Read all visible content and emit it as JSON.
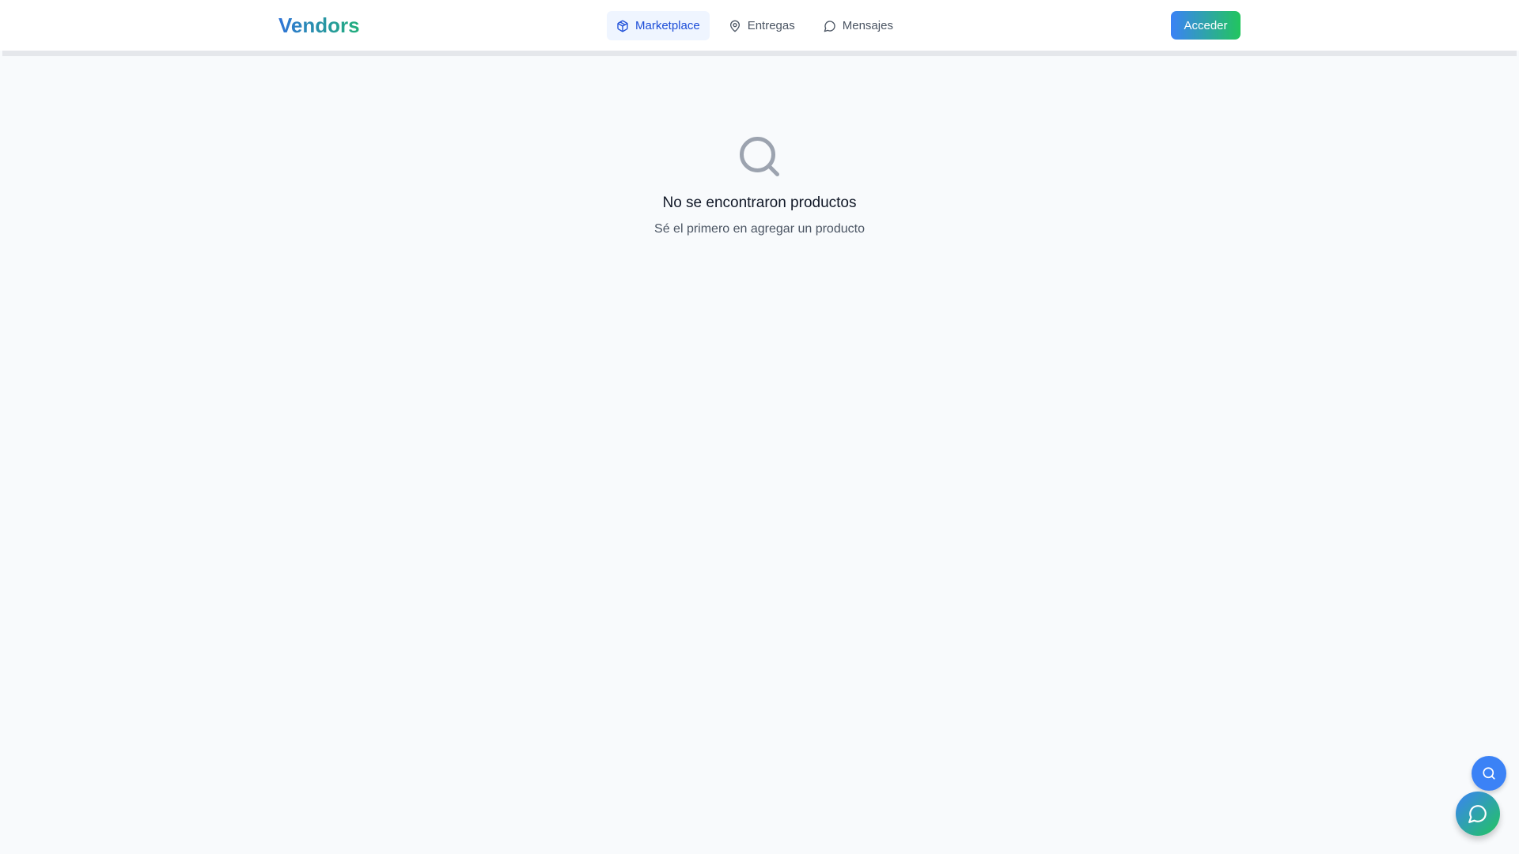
{
  "header": {
    "logo": "Vendors",
    "nav": [
      {
        "label": "Marketplace",
        "icon": "package-icon",
        "active": true
      },
      {
        "label": "Entregas",
        "icon": "map-pin-icon",
        "active": false
      },
      {
        "label": "Mensajes",
        "icon": "message-icon",
        "active": false
      }
    ],
    "login_label": "Acceder"
  },
  "empty_state": {
    "icon": "search-icon",
    "title": "No se encontraron productos",
    "subtitle": "Sé el primero en agregar un producto"
  },
  "fabs": {
    "search_icon": "search-icon",
    "chat_icon": "message-icon"
  },
  "colors": {
    "brand_blue": "#3b82f6",
    "brand_green": "#22c55e",
    "nav_active_bg": "#eff5ff",
    "background": "#f8fafc"
  }
}
